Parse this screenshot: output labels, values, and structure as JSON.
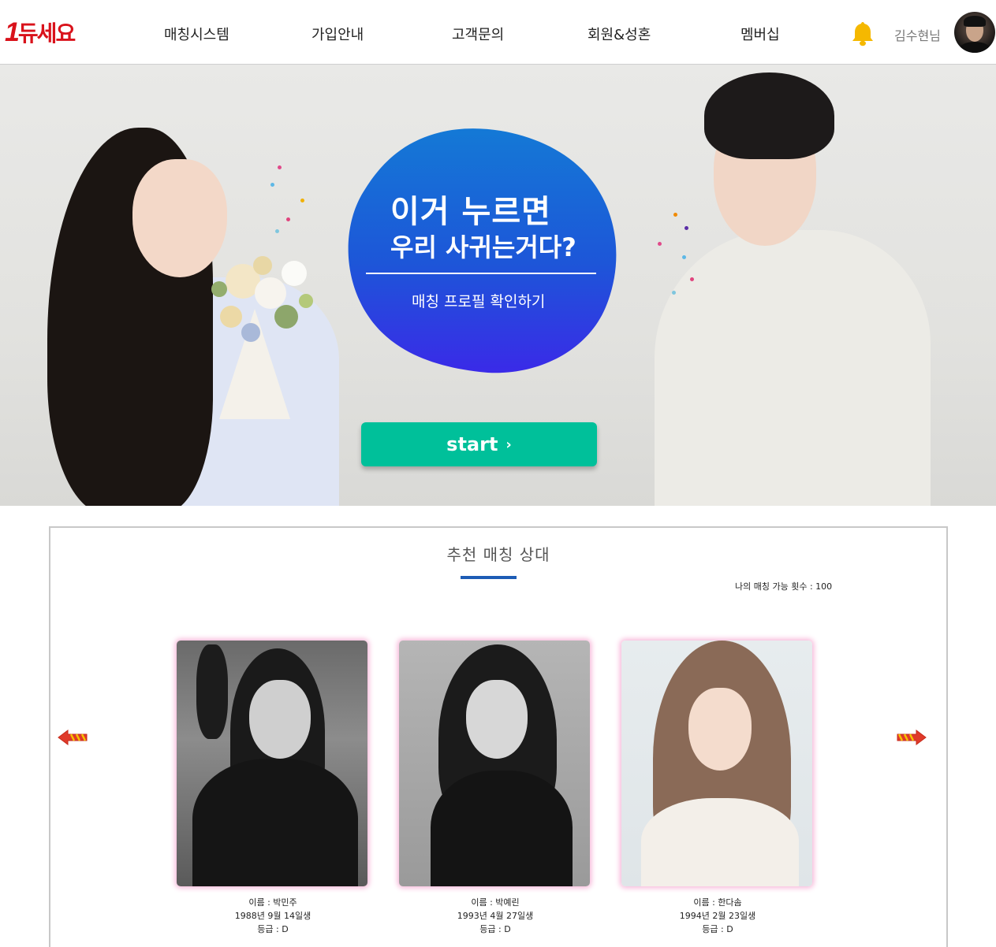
{
  "header": {
    "logo_number": "1",
    "logo_text": "듀세요",
    "nav": [
      "매칭시스템",
      "가입안내",
      "고객문의",
      "회원&성혼",
      "멤버십"
    ],
    "user_name": "김수현님",
    "bell_icon": "bell-icon",
    "accent_color": "#d9121b"
  },
  "hero": {
    "headline_line1": "이거 누르면",
    "headline_line2": "우리 사귀는거다?",
    "subtext": "매칭 프로필 확인하기",
    "start_label": "start",
    "start_color": "#00c09a",
    "blob_color": "#1e56d9"
  },
  "recommend": {
    "title": "추천 매칭 상대",
    "match_count_text": "나의 매칭 가능 횟수 : 100",
    "profiles": [
      {
        "name": "이름 : 박민주",
        "birth": "1988년 9월 14일생",
        "grade": "등급 : D"
      },
      {
        "name": "이름 : 박예린",
        "birth": "1993년 4월 27일생",
        "grade": "등급 : D"
      },
      {
        "name": "이름 : 한다솜",
        "birth": "1994년 2월 23일생",
        "grade": "등급 : D"
      }
    ]
  }
}
